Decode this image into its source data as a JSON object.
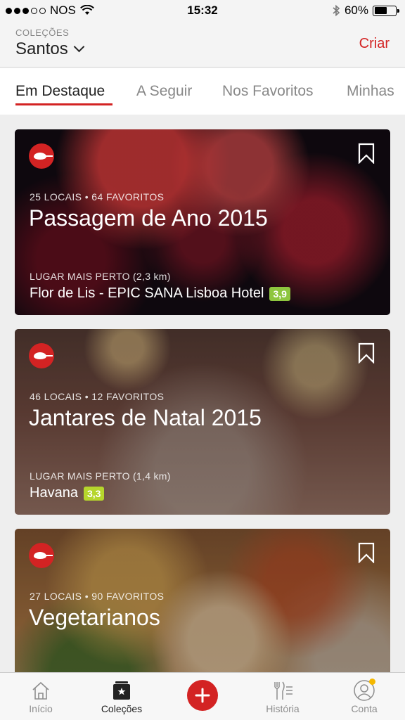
{
  "status_bar": {
    "carrier": "NOS",
    "time": "15:32",
    "battery": "60%",
    "battery_level": 0.6,
    "signal_bars_filled": 3,
    "signal_bars_total": 5
  },
  "header": {
    "subtitle": "COLEÇÕES",
    "title": "Santos",
    "action": "Criar"
  },
  "tabs": [
    {
      "label": "Em Destaque"
    },
    {
      "label": "A Seguir"
    },
    {
      "label": "Nos Favoritos"
    },
    {
      "label": "Minhas"
    }
  ],
  "cards": [
    {
      "meta": "25 LOCAIS • 64 FAVORITOS",
      "title": "Passagem de Ano 2015",
      "near_label": "LUGAR MAIS PERTO (2,3 km)",
      "place": "Flor de Lis - EPIC SANA Lisboa Hotel",
      "rating": "3,9"
    },
    {
      "meta": "46 LOCAIS • 12 FAVORITOS",
      "title": "Jantares de Natal 2015",
      "near_label": "LUGAR MAIS PERTO (1,4 km)",
      "place": "Havana",
      "rating": "3,3"
    },
    {
      "meta": "27 LOCAIS • 90 FAVORITOS",
      "title": "Vegetarianos"
    }
  ],
  "tabbar": {
    "items": [
      {
        "label": "Início",
        "icon": "home-icon"
      },
      {
        "label": "Coleções",
        "icon": "collections-icon"
      },
      {
        "label": "",
        "icon": "add-icon"
      },
      {
        "label": "História",
        "icon": "cutlery-list-icon"
      },
      {
        "label": "Conta",
        "icon": "user-icon"
      }
    ]
  },
  "colors": {
    "accent": "#d32323",
    "rating_green": "#8ec63f",
    "notification_dot": "#f5b800"
  }
}
